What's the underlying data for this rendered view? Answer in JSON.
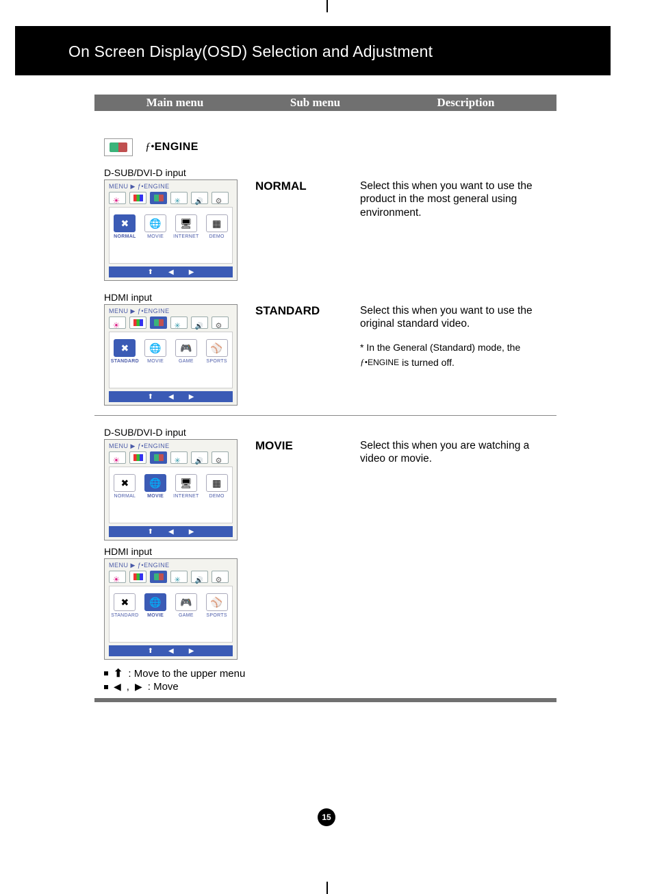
{
  "pageTitle": "On Screen Display(OSD) Selection and Adjustment",
  "columns": {
    "main": "Main menu",
    "sub": "Sub menu",
    "desc": "Description"
  },
  "engine": {
    "prefix": "ƒ•",
    "label": "ENGINE"
  },
  "osdCrumb": "MENU ▶ ƒ•ENGINE",
  "sectionA": {
    "inputLabel": "D-SUB/DVI-D input",
    "sub": "NORMAL",
    "desc": "Select this when you want to use the product in the most general using environment.",
    "modes": [
      "NORMAL",
      "MOVIE",
      "INTERNET",
      "DEMO"
    ],
    "selectedIndex": 0,
    "icons": [
      "✖",
      "🌐",
      "🖥",
      "▦"
    ]
  },
  "sectionB": {
    "inputLabel": "HDMI input",
    "sub": "STANDARD",
    "desc": "Select this when you want to use the original standard video.",
    "note1": "* In the General (Standard) mode, the",
    "note2_inline_prefix": "ƒ•",
    "note2_inline_label": "ENGINE",
    "note2_suffix": "  is turned off.",
    "modes": [
      "STANDARD",
      "MOVIE",
      "GAME",
      "SPORTS"
    ],
    "selectedIndex": 0,
    "icons": [
      "✖",
      "🌐",
      "🎮",
      "⚾"
    ]
  },
  "sectionC": {
    "inputLabel1": "D-SUB/DVI-D input",
    "inputLabel2": "HDMI input",
    "sub": "MOVIE",
    "desc": "Select this when you are watching a video or movie.",
    "modesA": [
      "NORMAL",
      "MOVIE",
      "INTERNET",
      "DEMO"
    ],
    "iconsA": [
      "✖",
      "🌐",
      "🖥",
      "▦"
    ],
    "modesB": [
      "STANDARD",
      "MOVIE",
      "GAME",
      "SPORTS"
    ],
    "iconsB": [
      "✖",
      "🌐",
      "🎮",
      "⚾"
    ],
    "selectedIndex": 1
  },
  "legend": {
    "row1": ": Move to the upper menu",
    "row2": ": Move",
    "lrSep": ","
  },
  "pageNumber": "15"
}
